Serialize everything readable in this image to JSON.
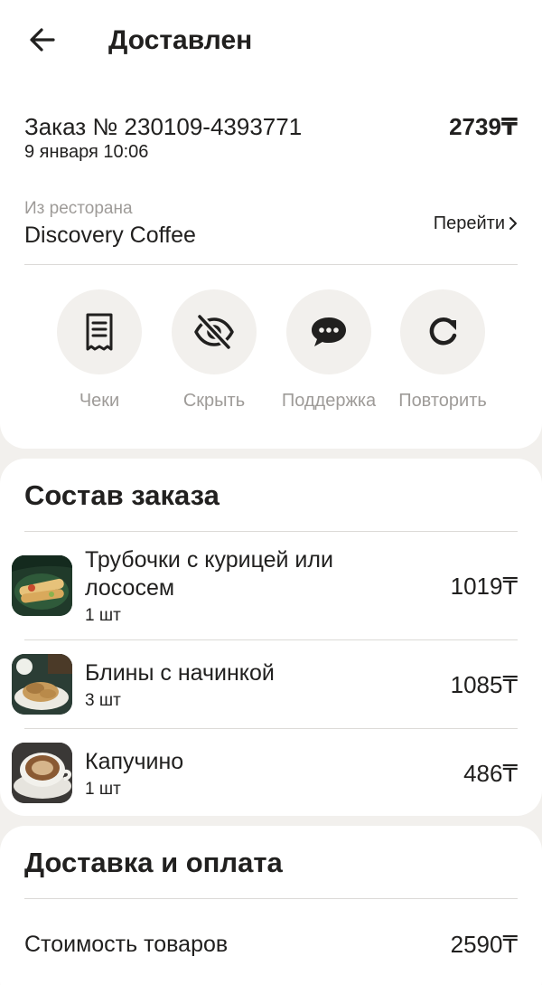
{
  "header": {
    "title": "Доставлен",
    "back_icon": "arrow-left-icon"
  },
  "order": {
    "number_label": "Заказ № 230109-4393771",
    "date": "9 января 10:06",
    "total": "2739₸",
    "restaurant_label": "Из ресторана",
    "restaurant_name": "Discovery Coffee",
    "goto_label": "Перейти"
  },
  "actions": [
    {
      "label": "Чеки",
      "icon": "receipt-icon"
    },
    {
      "label": "Скрыть",
      "icon": "eye-off-icon"
    },
    {
      "label": "Поддержка",
      "icon": "chat-icon"
    },
    {
      "label": "Повторить",
      "icon": "refresh-icon"
    }
  ],
  "composition": {
    "title": "Состав заказа",
    "items": [
      {
        "name": "Трубочки с курицей или лососем",
        "qty": "1 шт",
        "price": "1019₸"
      },
      {
        "name": "Блины с начинкой",
        "qty": "3 шт",
        "price": "1085₸"
      },
      {
        "name": "Капучино",
        "qty": "1 шт",
        "price": "486₸"
      }
    ]
  },
  "delivery": {
    "title": "Доставка и оплата",
    "goods_cost_label": "Стоимость товаров",
    "goods_cost_value": "2590₸"
  },
  "colors": {
    "background": "#f2f0ed",
    "card": "#ffffff",
    "text": "#21201f",
    "muted": "#9e9b98",
    "circle": "#f2f0ed"
  }
}
